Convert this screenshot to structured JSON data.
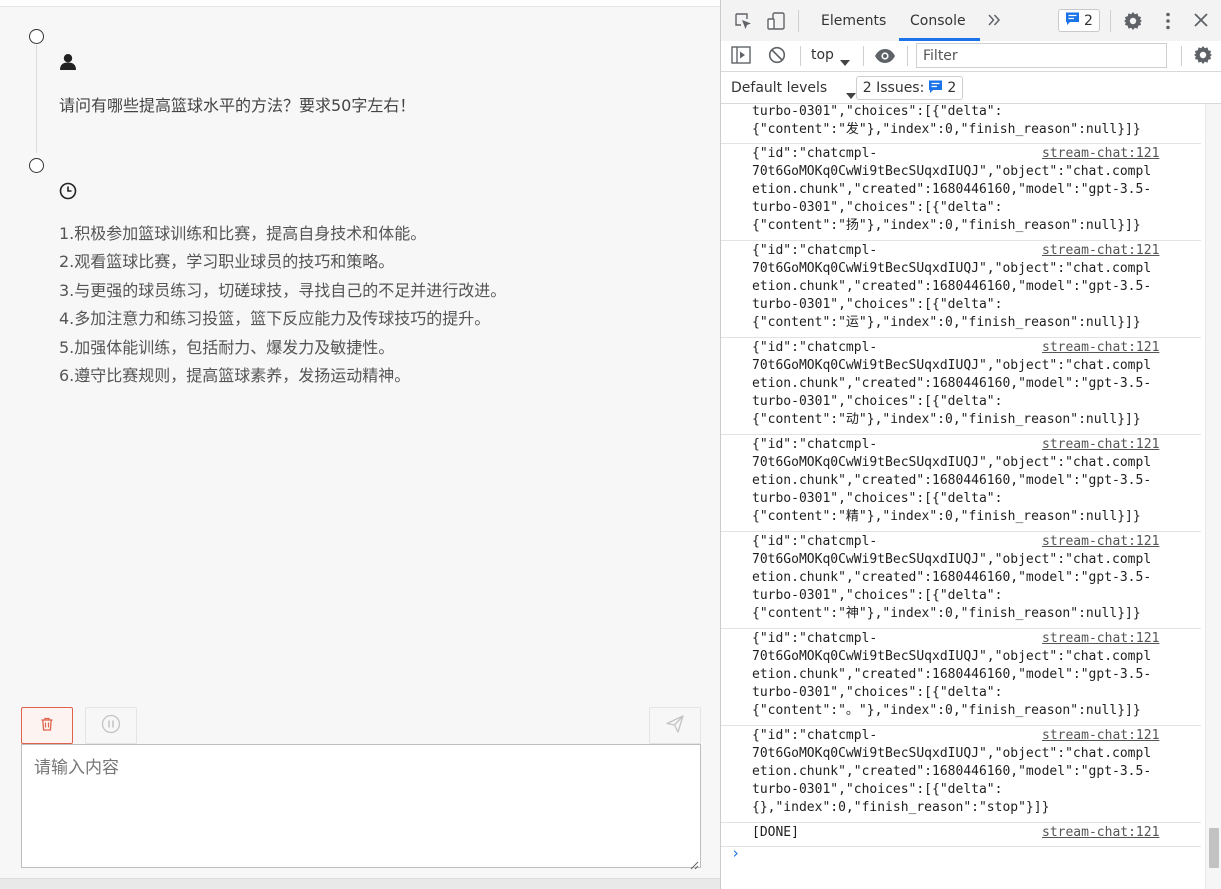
{
  "chat": {
    "user_question": "请问有哪些提高篮球水平的方法？要求50字左右！",
    "answer_lines": [
      "1.积极参加篮球训练和比赛，提高自身技术和体能。",
      "2.观看篮球比赛，学习职业球员的技巧和策略。",
      "3.与更强的球员练习，切磋球技，寻找自己的不足并进行改进。",
      "4.多加注意力和练习投篮，篮下反应能力及传球技巧的提升。",
      "5.加强体能训练，包括耐力、爆发力及敏捷性。",
      "6.遵守比赛规则，提高篮球素养，发扬运动精神。"
    ],
    "input_placeholder": "请输入内容",
    "icons": {
      "user": "user-icon",
      "assistant": "clock-icon",
      "clear": "trash-icon",
      "stop": "pause-icon",
      "send": "send-icon"
    },
    "colors": {
      "clear_accent": "#e0624d"
    }
  },
  "devtools": {
    "tabs": [
      "Elements",
      "Console"
    ],
    "active_tab": "Console",
    "messages_badge": "2",
    "context": "top",
    "filter_placeholder": "Filter",
    "default_levels": "Default levels",
    "issues_label": "2 Issues:",
    "issues_count": "2",
    "colors": {
      "accent": "#1a73e8"
    },
    "logs": [
      {
        "text": "turbo-0301\",\"choices\":[{\"delta\":\n{\"content\":\"发\"},\"index\":0,\"finish_reason\":null}]}",
        "source": ""
      },
      {
        "text": "{\"id\":\"chatcmpl-\n70t6GoMOKq0CwWi9tBecSUqxdIUQJ\",\"object\":\"chat.compl\netion.chunk\",\"created\":1680446160,\"model\":\"gpt-3.5-\nturbo-0301\",\"choices\":[{\"delta\":\n{\"content\":\"扬\"},\"index\":0,\"finish_reason\":null}]}",
        "source": "stream-chat:121"
      },
      {
        "text": "{\"id\":\"chatcmpl-\n70t6GoMOKq0CwWi9tBecSUqxdIUQJ\",\"object\":\"chat.compl\netion.chunk\",\"created\":1680446160,\"model\":\"gpt-3.5-\nturbo-0301\",\"choices\":[{\"delta\":\n{\"content\":\"运\"},\"index\":0,\"finish_reason\":null}]}",
        "source": "stream-chat:121"
      },
      {
        "text": "{\"id\":\"chatcmpl-\n70t6GoMOKq0CwWi9tBecSUqxdIUQJ\",\"object\":\"chat.compl\netion.chunk\",\"created\":1680446160,\"model\":\"gpt-3.5-\nturbo-0301\",\"choices\":[{\"delta\":\n{\"content\":\"动\"},\"index\":0,\"finish_reason\":null}]}",
        "source": "stream-chat:121"
      },
      {
        "text": "{\"id\":\"chatcmpl-\n70t6GoMOKq0CwWi9tBecSUqxdIUQJ\",\"object\":\"chat.compl\netion.chunk\",\"created\":1680446160,\"model\":\"gpt-3.5-\nturbo-0301\",\"choices\":[{\"delta\":\n{\"content\":\"精\"},\"index\":0,\"finish_reason\":null}]}",
        "source": "stream-chat:121"
      },
      {
        "text": "{\"id\":\"chatcmpl-\n70t6GoMOKq0CwWi9tBecSUqxdIUQJ\",\"object\":\"chat.compl\netion.chunk\",\"created\":1680446160,\"model\":\"gpt-3.5-\nturbo-0301\",\"choices\":[{\"delta\":\n{\"content\":\"神\"},\"index\":0,\"finish_reason\":null}]}",
        "source": "stream-chat:121"
      },
      {
        "text": "{\"id\":\"chatcmpl-\n70t6GoMOKq0CwWi9tBecSUqxdIUQJ\",\"object\":\"chat.compl\netion.chunk\",\"created\":1680446160,\"model\":\"gpt-3.5-\nturbo-0301\",\"choices\":[{\"delta\":\n{\"content\":\"。\"},\"index\":0,\"finish_reason\":null}]}",
        "source": "stream-chat:121"
      },
      {
        "text": "{\"id\":\"chatcmpl-\n70t6GoMOKq0CwWi9tBecSUqxdIUQJ\",\"object\":\"chat.compl\netion.chunk\",\"created\":1680446160,\"model\":\"gpt-3.5-\nturbo-0301\",\"choices\":[{\"delta\":\n{},\"index\":0,\"finish_reason\":\"stop\"}]}",
        "source": "stream-chat:121"
      },
      {
        "text": "[DONE]",
        "source": "stream-chat:121"
      }
    ]
  }
}
